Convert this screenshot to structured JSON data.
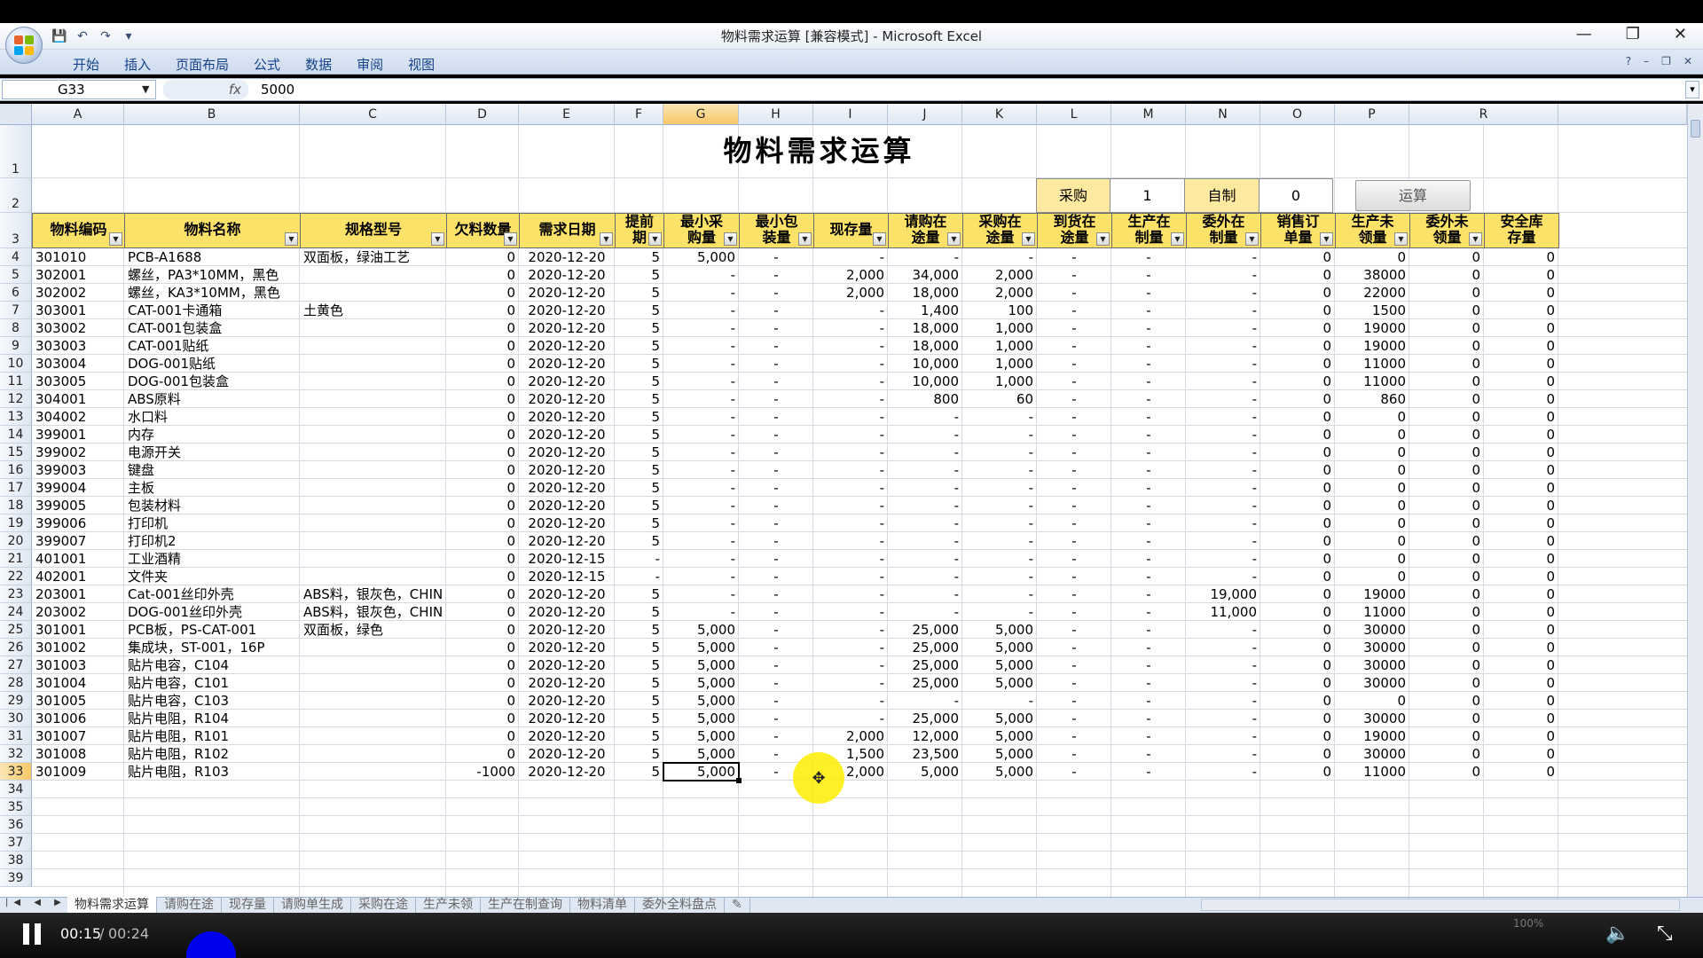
{
  "window": {
    "title": "物料需求运算  [兼容模式] - Microsoft Excel",
    "minimize": "—",
    "restore": "❐",
    "close": "✕"
  },
  "qat": [
    "💾",
    "↶",
    "↷",
    "▾"
  ],
  "ribbon": {
    "tabs": [
      "开始",
      "插入",
      "页面布局",
      "公式",
      "数据",
      "审阅",
      "视图"
    ],
    "right_controls": [
      "?",
      "–",
      "❐",
      "✕"
    ]
  },
  "formula_bar": {
    "name_box": "G33",
    "fx": "fx",
    "value": "5000"
  },
  "columns": [
    "A",
    "B",
    "C",
    "D",
    "E",
    "F",
    "G",
    "H",
    "I",
    "J",
    "K",
    "L",
    "M",
    "N",
    "O",
    "P",
    "R"
  ],
  "row_numbers": [
    "1",
    "2",
    "3",
    "4",
    "5",
    "6",
    "7",
    "8",
    "9",
    "10",
    "11",
    "12",
    "13",
    "14",
    "15",
    "16",
    "17",
    "18",
    "19",
    "20",
    "21",
    "22",
    "23",
    "24",
    "25",
    "26",
    "27",
    "28",
    "29",
    "30",
    "31",
    "32",
    "33",
    "34",
    "35",
    "36",
    "37",
    "38",
    "39"
  ],
  "sheet": {
    "title": "物料需求运算",
    "controls": {
      "purchase_label": "采购",
      "purchase_value": "1",
      "self_made_label": "自制",
      "self_made_value": "0",
      "run_button": "运算"
    },
    "headers": [
      "物料编码",
      "物料名称",
      "规格型号",
      "欠料数量",
      "需求日期",
      "提前\n期",
      "最小采\n购量",
      "最小包\n装量",
      "现存量",
      "请购在\n途量",
      "采购在\n途量",
      "到货在\n途量",
      "生产在\n制量",
      "委外在\n制量",
      "销售订\n单量",
      "生产未\n领量",
      "委外未\n领量",
      "安全库\n存量"
    ],
    "filter_icon": "▼",
    "rows": [
      [
        "301010",
        "PCB-A1688",
        "双面板，绿油工艺",
        "0",
        "2020-12-20",
        "5",
        "5,000",
        "-",
        "-",
        "-",
        "-",
        "-",
        "-",
        "-",
        "0",
        "0",
        "0",
        "0"
      ],
      [
        "302001",
        "螺丝，PA3*10MM，黑色",
        "",
        "0",
        "2020-12-20",
        "5",
        "-",
        "-",
        "2,000",
        "34,000",
        "2,000",
        "-",
        "-",
        "-",
        "0",
        "38000",
        "0",
        "0"
      ],
      [
        "302002",
        "螺丝，KA3*10MM，黑色",
        "",
        "0",
        "2020-12-20",
        "5",
        "-",
        "-",
        "2,000",
        "18,000",
        "2,000",
        "-",
        "-",
        "-",
        "0",
        "22000",
        "0",
        "0"
      ],
      [
        "303001",
        "CAT-001卡通箱",
        "土黄色",
        "0",
        "2020-12-20",
        "5",
        "-",
        "-",
        "-",
        "1,400",
        "100",
        "-",
        "-",
        "-",
        "0",
        "1500",
        "0",
        "0"
      ],
      [
        "303002",
        "CAT-001包装盒",
        "",
        "0",
        "2020-12-20",
        "5",
        "-",
        "-",
        "-",
        "18,000",
        "1,000",
        "-",
        "-",
        "-",
        "0",
        "19000",
        "0",
        "0"
      ],
      [
        "303003",
        "CAT-001贴纸",
        "",
        "0",
        "2020-12-20",
        "5",
        "-",
        "-",
        "-",
        "18,000",
        "1,000",
        "-",
        "-",
        "-",
        "0",
        "19000",
        "0",
        "0"
      ],
      [
        "303004",
        "DOG-001贴纸",
        "",
        "0",
        "2020-12-20",
        "5",
        "-",
        "-",
        "-",
        "10,000",
        "1,000",
        "-",
        "-",
        "-",
        "0",
        "11000",
        "0",
        "0"
      ],
      [
        "303005",
        "DOG-001包装盒",
        "",
        "0",
        "2020-12-20",
        "5",
        "-",
        "-",
        "-",
        "10,000",
        "1,000",
        "-",
        "-",
        "-",
        "0",
        "11000",
        "0",
        "0"
      ],
      [
        "304001",
        "ABS原料",
        "",
        "0",
        "2020-12-20",
        "5",
        "-",
        "-",
        "-",
        "800",
        "60",
        "-",
        "-",
        "-",
        "0",
        "860",
        "0",
        "0"
      ],
      [
        "304002",
        "水口料",
        "",
        "0",
        "2020-12-20",
        "5",
        "-",
        "-",
        "-",
        "-",
        "-",
        "-",
        "-",
        "-",
        "0",
        "0",
        "0",
        "0"
      ],
      [
        "399001",
        "内存",
        "",
        "0",
        "2020-12-20",
        "5",
        "-",
        "-",
        "-",
        "-",
        "-",
        "-",
        "-",
        "-",
        "0",
        "0",
        "0",
        "0"
      ],
      [
        "399002",
        "电源开关",
        "",
        "0",
        "2020-12-20",
        "5",
        "-",
        "-",
        "-",
        "-",
        "-",
        "-",
        "-",
        "-",
        "0",
        "0",
        "0",
        "0"
      ],
      [
        "399003",
        "键盘",
        "",
        "0",
        "2020-12-20",
        "5",
        "-",
        "-",
        "-",
        "-",
        "-",
        "-",
        "-",
        "-",
        "0",
        "0",
        "0",
        "0"
      ],
      [
        "399004",
        "主板",
        "",
        "0",
        "2020-12-20",
        "5",
        "-",
        "-",
        "-",
        "-",
        "-",
        "-",
        "-",
        "-",
        "0",
        "0",
        "0",
        "0"
      ],
      [
        "399005",
        "包装材料",
        "",
        "0",
        "2020-12-20",
        "5",
        "-",
        "-",
        "-",
        "-",
        "-",
        "-",
        "-",
        "-",
        "0",
        "0",
        "0",
        "0"
      ],
      [
        "399006",
        "打印机",
        "",
        "0",
        "2020-12-20",
        "5",
        "-",
        "-",
        "-",
        "-",
        "-",
        "-",
        "-",
        "-",
        "0",
        "0",
        "0",
        "0"
      ],
      [
        "399007",
        "打印机2",
        "",
        "0",
        "2020-12-20",
        "5",
        "-",
        "-",
        "-",
        "-",
        "-",
        "-",
        "-",
        "-",
        "0",
        "0",
        "0",
        "0"
      ],
      [
        "401001",
        "工业酒精",
        "",
        "0",
        "2020-12-15",
        "-",
        "-",
        "-",
        "-",
        "-",
        "-",
        "-",
        "-",
        "-",
        "0",
        "0",
        "0",
        "0"
      ],
      [
        "402001",
        "文件夹",
        "",
        "0",
        "2020-12-15",
        "-",
        "-",
        "-",
        "-",
        "-",
        "-",
        "-",
        "-",
        "-",
        "0",
        "0",
        "0",
        "0"
      ],
      [
        "203001",
        "Cat-001丝印外壳",
        "ABS料，银灰色，CHIN",
        "0",
        "2020-12-20",
        "5",
        "-",
        "-",
        "-",
        "-",
        "-",
        "-",
        "-",
        "19,000",
        "0",
        "19000",
        "0",
        "0"
      ],
      [
        "203002",
        "DOG-001丝印外壳",
        "ABS料，银灰色，CHIN",
        "0",
        "2020-12-20",
        "5",
        "-",
        "-",
        "-",
        "-",
        "-",
        "-",
        "-",
        "11,000",
        "0",
        "11000",
        "0",
        "0"
      ],
      [
        "301001",
        "PCB板，PS-CAT-001",
        "双面板，绿色",
        "0",
        "2020-12-20",
        "5",
        "5,000",
        "-",
        "-",
        "25,000",
        "5,000",
        "-",
        "-",
        "-",
        "0",
        "30000",
        "0",
        "0"
      ],
      [
        "301002",
        "集成块，ST-001，16P",
        "",
        "0",
        "2020-12-20",
        "5",
        "5,000",
        "-",
        "-",
        "25,000",
        "5,000",
        "-",
        "-",
        "-",
        "0",
        "30000",
        "0",
        "0"
      ],
      [
        "301003",
        "贴片电容，C104",
        "",
        "0",
        "2020-12-20",
        "5",
        "5,000",
        "-",
        "-",
        "25,000",
        "5,000",
        "-",
        "-",
        "-",
        "0",
        "30000",
        "0",
        "0"
      ],
      [
        "301004",
        "贴片电容，C101",
        "",
        "0",
        "2020-12-20",
        "5",
        "5,000",
        "-",
        "-",
        "25,000",
        "5,000",
        "-",
        "-",
        "-",
        "0",
        "30000",
        "0",
        "0"
      ],
      [
        "301005",
        "贴片电容，C103",
        "",
        "0",
        "2020-12-20",
        "5",
        "5,000",
        "-",
        "-",
        "-",
        "-",
        "-",
        "-",
        "-",
        "0",
        "0",
        "0",
        "0"
      ],
      [
        "301006",
        "贴片电阻，R104",
        "",
        "0",
        "2020-12-20",
        "5",
        "5,000",
        "-",
        "-",
        "25,000",
        "5,000",
        "-",
        "-",
        "-",
        "0",
        "30000",
        "0",
        "0"
      ],
      [
        "301007",
        "贴片电阻，R101",
        "",
        "0",
        "2020-12-20",
        "5",
        "5,000",
        "-",
        "2,000",
        "12,000",
        "5,000",
        "-",
        "-",
        "-",
        "0",
        "19000",
        "0",
        "0"
      ],
      [
        "301008",
        "贴片电阻，R102",
        "",
        "0",
        "2020-12-20",
        "5",
        "5,000",
        "-",
        "1,500",
        "23,500",
        "5,000",
        "-",
        "-",
        "-",
        "0",
        "30000",
        "0",
        "0"
      ],
      [
        "301009",
        "贴片电阻，R103",
        "",
        "-1000",
        "2020-12-20",
        "5",
        "5,000",
        "-",
        "2,000",
        "5,000",
        "5,000",
        "-",
        "-",
        "-",
        "0",
        "11000",
        "0",
        "0"
      ]
    ]
  },
  "cursor_icon": "✥",
  "sheet_tabs": [
    "物料需求运算",
    "请购在途",
    "现存量",
    "请购单生成",
    "采购在途",
    "生产未领",
    "生产在制查询",
    "物料清单",
    "委外全料盘点",
    "✎"
  ],
  "tab_nav": "|◀ ◀ ▶ ▶|",
  "video": {
    "current_time": "00:15",
    "separator": "/",
    "total_time": "00:24",
    "volume_icon": "🔈",
    "fullscreen_icon": "⤡",
    "zoom_level": "100%"
  },
  "colors": {
    "header_yellow": "#fde26a",
    "control_yellow": "#fde9a0",
    "selected_column": "#f6c868",
    "highlight": "#ffec00"
  }
}
